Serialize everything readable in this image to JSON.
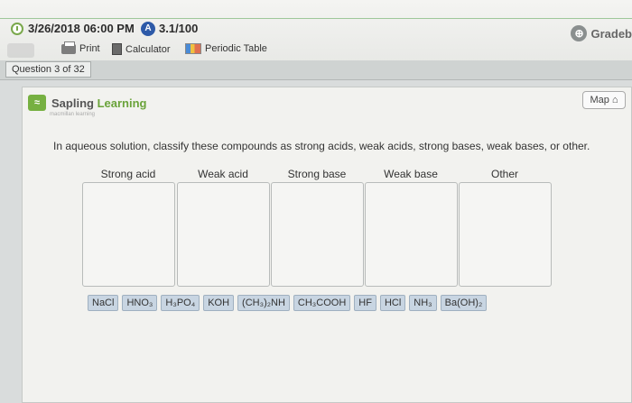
{
  "header": {
    "datetime": "3/26/2018 06:00 PM",
    "score_icon": "A",
    "score": "3.1/100",
    "tools": [
      "Print",
      "Calculator",
      "Periodic Table"
    ],
    "gradebook": "Gradeb"
  },
  "question": {
    "label": "Question 3 of 32"
  },
  "panel": {
    "logo_brand": "Sapling",
    "logo_accent": "Learning",
    "logo_sub": "macmillan learning",
    "map_label": "Map",
    "prompt": "In aqueous solution, classify these compounds as strong acids, weak acids, strong bases, weak bases, or other.",
    "columns": [
      "Strong acid",
      "Weak acid",
      "Strong base",
      "Weak base",
      "Other"
    ],
    "compounds": [
      "NaCl",
      "HNO₃",
      "H₃PO₄",
      "KOH",
      "(CH₃)₂NH",
      "CH₃COOH",
      "HF",
      "HCl",
      "NH₃",
      "Ba(OH)₂"
    ]
  },
  "colors": {
    "brand_green": "#76b041",
    "score_blue": "#2d5aa8",
    "chip_bg": "#c8d5e2"
  }
}
